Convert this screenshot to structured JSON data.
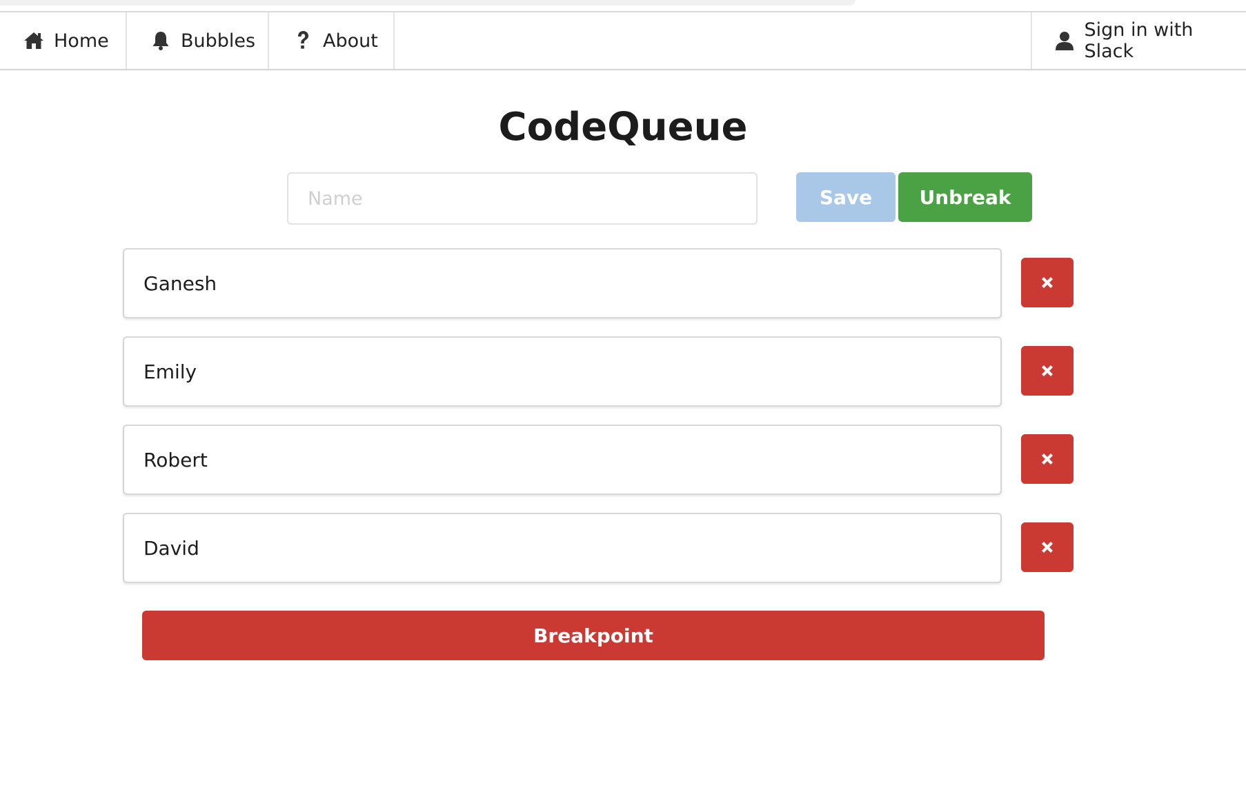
{
  "navbar": {
    "items": [
      {
        "label": "Home",
        "icon": "home-icon"
      },
      {
        "label": "Bubbles",
        "icon": "bell-icon"
      },
      {
        "label": "About",
        "icon": "question-icon"
      }
    ],
    "signin": {
      "label": "Sign in with Slack",
      "icon": "user-icon"
    }
  },
  "page": {
    "title": "CodeQueue"
  },
  "form": {
    "name_placeholder": "Name",
    "name_value": "",
    "save_label": "Save",
    "unbreak_label": "Unbreak"
  },
  "queue": {
    "items": [
      {
        "name": "Ganesh"
      },
      {
        "name": "Emily"
      },
      {
        "name": "Robert"
      },
      {
        "name": "David"
      }
    ],
    "remove_icon": "close-icon"
  },
  "breakpoint_label": "Breakpoint",
  "colors": {
    "save": "#a9c8e8",
    "unbreak": "#4aa244",
    "danger": "#cb3a32",
    "text": "#222222"
  }
}
